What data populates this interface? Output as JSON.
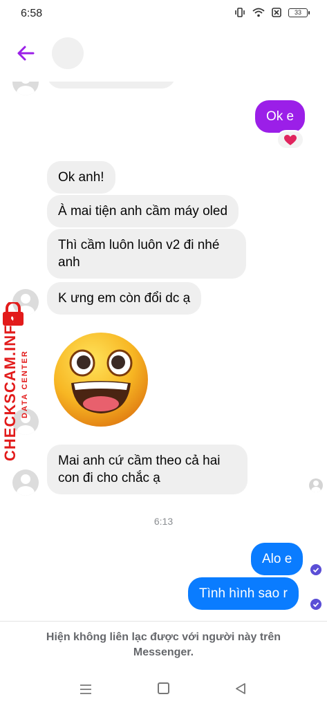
{
  "status_bar": {
    "time": "6:58",
    "battery": "33"
  },
  "messages": {
    "sent_ok": "Ok e",
    "reaction": "❤️",
    "received": [
      "Ok anh!",
      "À mai tiện anh cầm máy oled",
      "Thì cầm luôn luôn v2 đi nhé anh",
      "K ưng em còn đổi dc ạ",
      "Mai anh cứ cầm theo cả hai con đi cho chắc ạ"
    ],
    "emoji_sticker": "😃",
    "time_separator": "6:13",
    "sent_later": [
      "Alo e",
      "Tình hình sao r"
    ]
  },
  "watermark": {
    "line1": "DATA CENTER",
    "line2": "CHECKSCAM.INFO"
  },
  "footer": {
    "notice": "Hiện không liên lạc được với người này trên Messenger."
  },
  "colors": {
    "accent": "#9b1fe8",
    "messenger_blue": "#0a7cff",
    "bubble_gray": "#efefef",
    "watermark_red": "#e21b1b"
  }
}
